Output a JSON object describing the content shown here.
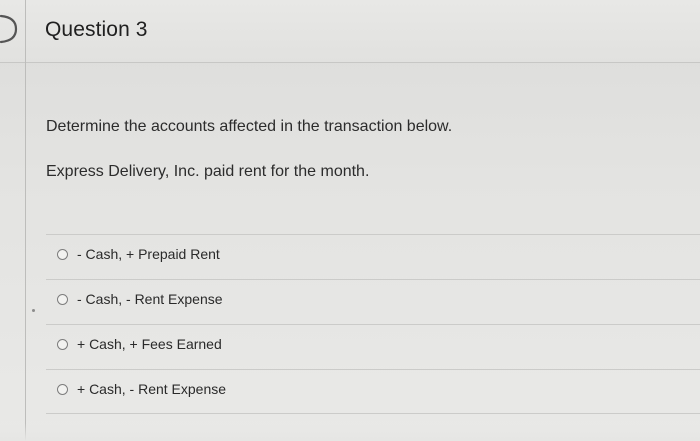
{
  "question": {
    "title": "Question 3",
    "prompt": "Determine the accounts affected in the transaction below.",
    "scenario": "Express Delivery, Inc. paid rent for the month.",
    "options": [
      {
        "label": "- Cash, + Prepaid Rent"
      },
      {
        "label": "- Cash, - Rent Expense"
      },
      {
        "label": "+ Cash, + Fees Earned"
      },
      {
        "label": "+ Cash, - Rent Expense"
      }
    ]
  },
  "icons": {
    "header_marker": "question-marker-icon",
    "radio": "radio-button-icon"
  },
  "colors": {
    "background": "#e3e3e1",
    "border": "#c7c7c5",
    "text": "#2f2f2f"
  }
}
